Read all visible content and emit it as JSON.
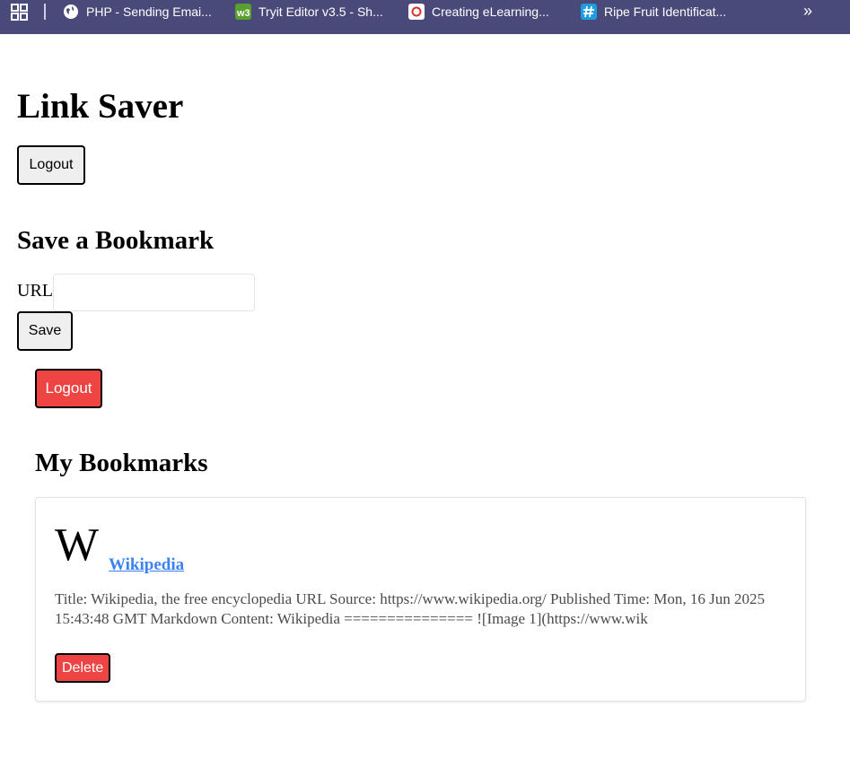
{
  "bookmarks_bar": {
    "items": [
      {
        "label": "PHP - Sending Emai...",
        "icon": "globe-icon"
      },
      {
        "label": "Tryit Editor v3.5 - Sh...",
        "icon": "w3schools-icon"
      },
      {
        "label": "Creating eLearning...",
        "icon": "elearning-icon"
      },
      {
        "label": "Ripe Fruit Identificat...",
        "icon": "hash-icon"
      }
    ],
    "overflow_icon": "double-chevron-right-icon",
    "overflow_glyph": "»"
  },
  "page": {
    "title": "Link Saver",
    "logout_label": "Logout",
    "save_section": {
      "heading": "Save a Bookmark",
      "url_label": "URL",
      "url_value": "",
      "save_label": "Save"
    },
    "secondary_logout_label": "Logout",
    "bookmarks_heading": "My Bookmarks",
    "bookmarks": [
      {
        "logo_glyph": "W",
        "title": "Wikipedia",
        "description": "Title: Wikipedia, the free encyclopedia URL Source: https://www.wikipedia.org/ Published Time: Mon, 16 Jun 2025 15:43:48 GMT Markdown Content: Wikipedia =============== ![Image 1](https://www.wik",
        "delete_label": "Delete"
      }
    ]
  },
  "colors": {
    "bar_bg": "#4a4a7a",
    "danger": "#ef4444",
    "link": "#3b82f6"
  }
}
